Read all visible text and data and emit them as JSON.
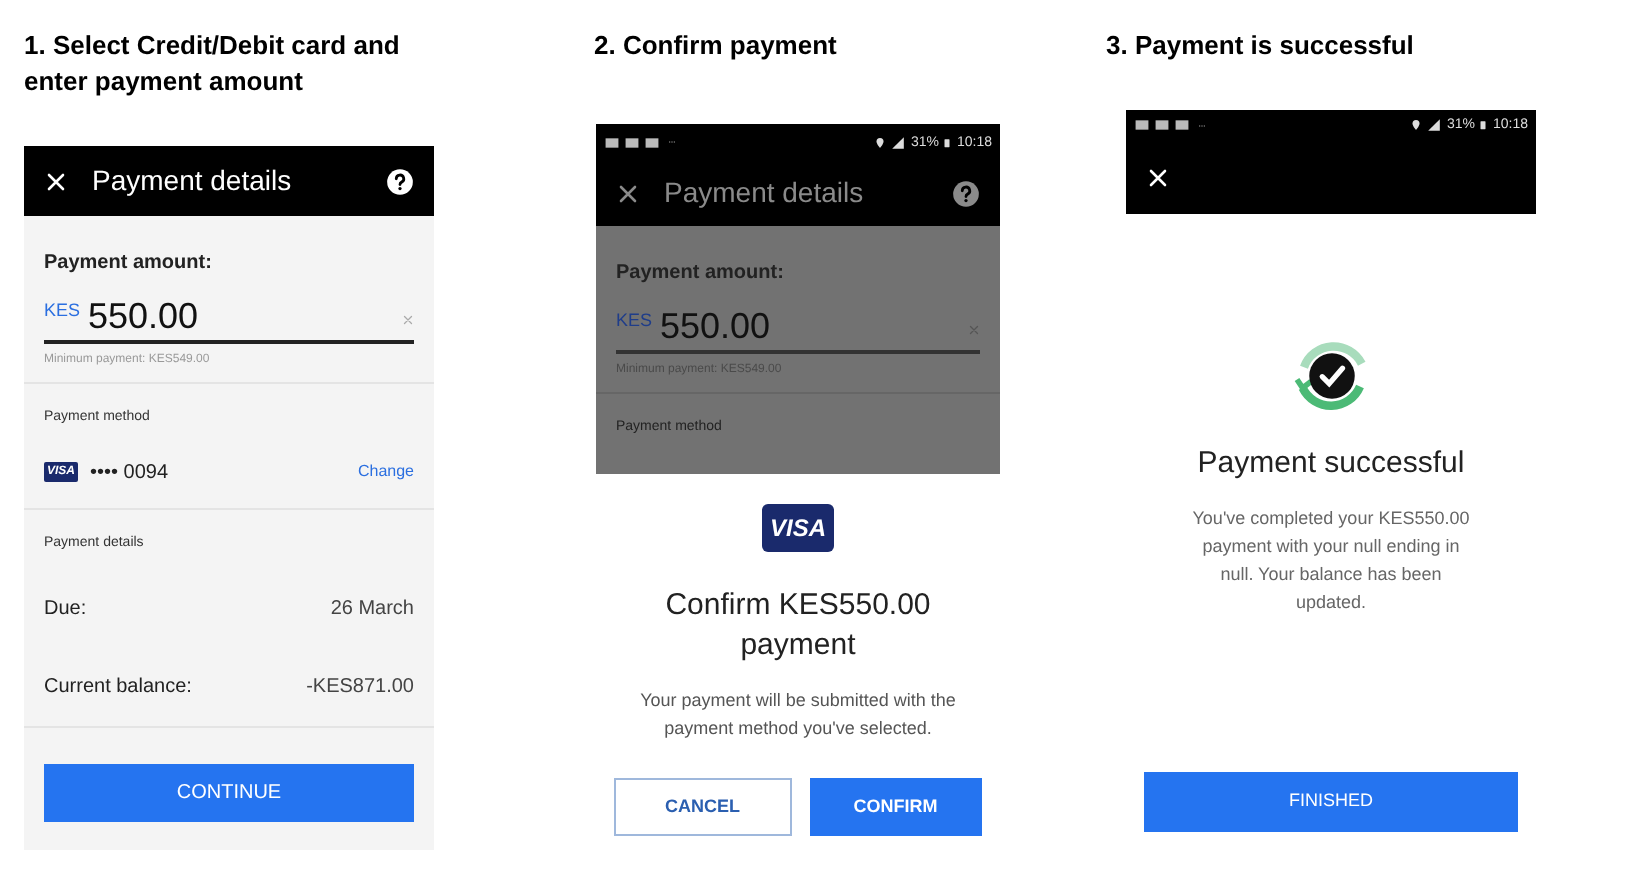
{
  "steps": [
    {
      "kind": "details",
      "caption": "1. Select Credit/Debit card and enter payment amount",
      "title": "Payment details",
      "amount_label": "Payment amount:",
      "currency": "KES",
      "amount": "550.00",
      "minimum": "Minimum payment: KES549.00",
      "method_label": "Payment method",
      "card_brand": "VISA",
      "card_number": "•••• 0094",
      "change_link": "Change",
      "details_label": "Payment details",
      "rows": [
        {
          "label": "Due:",
          "value": "26 March"
        },
        {
          "label": "Current balance:",
          "value": "-KES871.00"
        }
      ],
      "button": "CONTINUE"
    },
    {
      "kind": "confirm",
      "caption": "2. Confirm payment",
      "status_bar": {
        "battery": "31%",
        "time": "10:18"
      },
      "title": "Payment details",
      "amount_label": "Payment amount:",
      "currency": "KES",
      "amount": "550.00",
      "minimum": "Minimum payment: KES549.00",
      "method_label": "Payment method",
      "card_brand": "VISA",
      "heading": "Confirm KES550.00 payment",
      "message": "Your payment will be submitted with the payment method you've selected.",
      "buttons": [
        {
          "label": "CANCEL",
          "primary": false
        },
        {
          "label": "CONFIRM",
          "primary": true
        }
      ]
    },
    {
      "kind": "success",
      "caption": "3. Payment is successful",
      "status_bar": {
        "battery": "31%",
        "time": "10:18"
      },
      "heading": "Payment successful",
      "message": "You've completed your KES550.00 payment with your null ending in null. Your balance has been updated.",
      "button": "FINISHED"
    }
  ]
}
